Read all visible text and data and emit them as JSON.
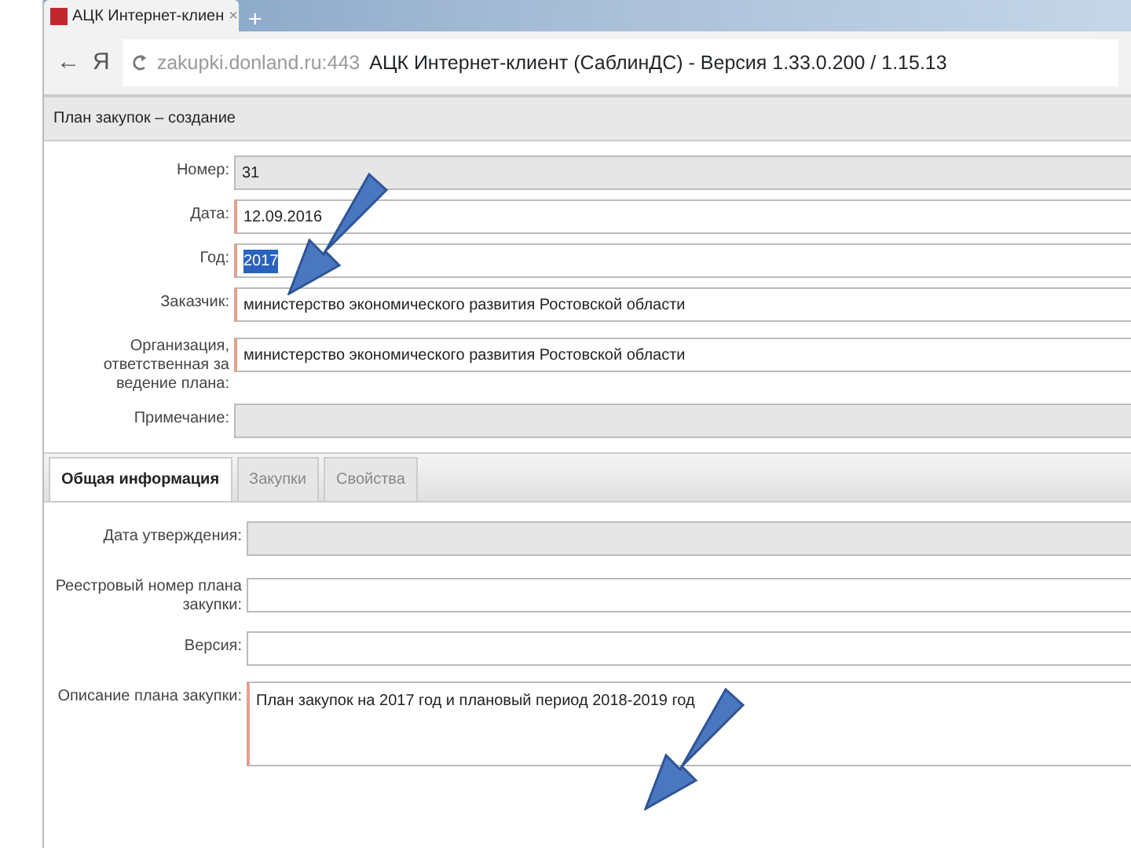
{
  "browser": {
    "tab_title": "АЦК Интернет-клиен",
    "tab_close": "×",
    "new_tab": "+",
    "back": "←",
    "yandex": "Я",
    "url": "zakupki.donland.ru:443",
    "page_title": "АЦК Интернет-клиент (СаблинДС) - Версия 1.33.0.200 / 1.15.13"
  },
  "header": {
    "title": "План закупок – создание"
  },
  "fields": [
    {
      "label": "Номер:",
      "value": "31",
      "disabled": true,
      "required": false,
      "text_selected": false,
      "kind": "input"
    },
    {
      "label": "Дата:",
      "value": "12.09.2016",
      "disabled": false,
      "required": true,
      "text_selected": false,
      "kind": "input"
    },
    {
      "label": "Год:",
      "value": "2017",
      "disabled": false,
      "required": true,
      "text_selected": true,
      "kind": "input"
    },
    {
      "label": "Заказчик:",
      "value": "министерство экономического развития Ростовской области",
      "disabled": false,
      "required": true,
      "text_selected": false,
      "kind": "input"
    },
    {
      "label": "Организация, ответственная за ведение плана:",
      "value": "министерство экономического развития Ростовской области",
      "disabled": false,
      "required": true,
      "text_selected": false,
      "kind": "tall"
    },
    {
      "label": "Примечание:",
      "disabled": true,
      "required": false,
      "text_selected": false,
      "kind": "input"
    }
  ],
  "tabs": [
    {
      "label": "Общая информация",
      "selected": true
    },
    {
      "label": "Закупки",
      "selected": false
    },
    {
      "label": "Свойства",
      "selected": false
    }
  ],
  "tab_fields": [
    {
      "label": "Дата утверждения:",
      "disabled": true,
      "required": false,
      "kind": "input"
    },
    {
      "label": "Реестровый номер плана закупки:",
      "disabled": false,
      "required": false,
      "kind": "tall"
    },
    {
      "label": "Версия:",
      "disabled": false,
      "required": false,
      "kind": "input"
    },
    {
      "label": "Описание плана закупки:",
      "value": "План закупок на 2017 год и плановый период 2018-2019 год",
      "disabled": false,
      "required": true,
      "kind": "area"
    }
  ]
}
